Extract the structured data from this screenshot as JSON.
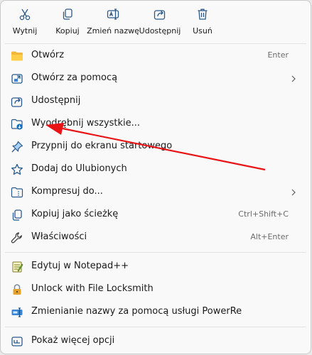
{
  "toolbar": {
    "cut": "Wytnij",
    "copy": "Kopiuj",
    "rename": "Zmień nazwę",
    "share": "Udostępnij",
    "delete": "Usuń"
  },
  "items": [
    {
      "label": "Otwórz",
      "shortcut": "Enter",
      "icon": "folder-icon"
    },
    {
      "label": "Otwórz za pomocą",
      "icon": "open-with-icon",
      "submenu": true
    },
    {
      "label": "Udostępnij",
      "icon": "share-icon"
    },
    {
      "label": "Wyodrębnij wszystkie...",
      "icon": "extract-icon"
    },
    {
      "label": "Przypnij do ekranu startowego",
      "icon": "pin-icon"
    },
    {
      "label": "Dodaj do Ulubionych",
      "icon": "star-icon"
    },
    {
      "label": "Kompresuj do...",
      "icon": "compress-icon",
      "submenu": true
    },
    {
      "label": "Kopiuj jako ścieżkę",
      "shortcut": "Ctrl+Shift+C",
      "icon": "copy-path-icon"
    },
    {
      "label": "Właściwości",
      "shortcut": "Alt+Enter",
      "icon": "wrench-icon"
    },
    {
      "label": "Edytuj w Notepad++",
      "icon": "notepad-icon"
    },
    {
      "label": "Unlock with File Locksmith",
      "icon": "lock-icon"
    },
    {
      "label": "Zmienianie nazwy za pomocą usługi PowerRe",
      "icon": "powerrename-icon"
    },
    {
      "label": "Pokaż więcej opcji",
      "icon": "more-options-icon"
    }
  ],
  "colors": {
    "accent": "#0f6cbd",
    "annotation_arrow": "#e81416"
  }
}
